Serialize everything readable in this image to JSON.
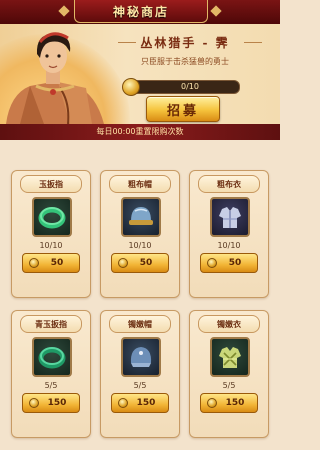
{
  "header": {
    "title": "神秘商店"
  },
  "banner": {
    "hero_name": "丛林猎手 - 霁",
    "hero_desc": "只臣服于击杀猛兽的勇士",
    "ticket_count": "0/10",
    "recruit_label": "招募"
  },
  "notice": {
    "text": "每日00:00重置限购次数"
  },
  "shop": {
    "items": [
      {
        "name": "玉扳指",
        "stock": "10/10",
        "price": "50",
        "icon": "jade-ring-icon"
      },
      {
        "name": "粗布帽",
        "stock": "10/10",
        "price": "50",
        "icon": "cloth-hat-icon"
      },
      {
        "name": "粗布衣",
        "stock": "10/10",
        "price": "50",
        "icon": "cloth-armor-icon"
      },
      {
        "name": "青玉扳指",
        "stock": "5/5",
        "price": "150",
        "icon": "green-jade-ring-icon"
      },
      {
        "name": "镯嫩帽",
        "stock": "5/5",
        "price": "150",
        "icon": "bracelet-hat-icon"
      },
      {
        "name": "镯嫩衣",
        "stock": "5/5",
        "price": "150",
        "icon": "bracelet-armor-icon"
      }
    ]
  },
  "colors": {
    "header_red": "#7a1414",
    "gold_accent": "#f2b536",
    "parchment": "#f3e3cc"
  }
}
